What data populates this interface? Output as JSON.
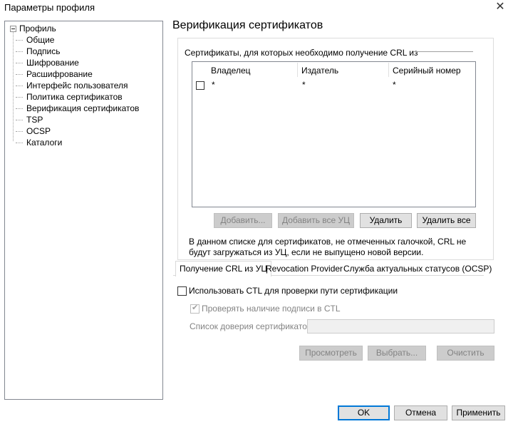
{
  "window": {
    "title": "Параметры профиля",
    "close_glyph": "✕"
  },
  "tree": {
    "root": "Профиль",
    "items": [
      "Общие",
      "Подпись",
      "Шифрование",
      "Расшифрование",
      "Интерфейс пользователя",
      "Политика сертификатов",
      "Верификация сертификатов",
      "TSP",
      "OCSP",
      "Каталоги"
    ],
    "selected": "Верификация сертификатов"
  },
  "page": {
    "title": "Верификация сертификатов",
    "group_caption": "Сертификаты, для которых необходимо получение CRL из",
    "table": {
      "columns": [
        "Владелец",
        "Издатель",
        "Серийный номер"
      ],
      "rows": [
        {
          "checked": false,
          "owner": "*",
          "issuer": "*",
          "serial": "*"
        }
      ]
    },
    "buttons": {
      "add": "Добавить...",
      "add_all_ca": "Добавить все УЦ",
      "remove": "Удалить",
      "remove_all": "Удалить все"
    },
    "note": "В данном списке для сертификатов, не отмеченных галочкой, CRL не будут загружаться из УЦ, если не выпущено новой версии."
  },
  "tabs": [
    {
      "label": "Получение CRL из УЦ",
      "active": true
    },
    {
      "label": "Revocation Provider",
      "active": false
    },
    {
      "label": "Служба актуальных статусов (OCSP)",
      "active": false
    }
  ],
  "ctl": {
    "use_ctl_label": "Использовать CTL для проверки пути сертификации",
    "use_ctl_checked": false,
    "verify_sig_label": "Проверять наличие подписи в CTL",
    "verify_sig_checked": true,
    "trust_list_label": "Список доверия сертификатов:",
    "trust_list_value": "",
    "buttons": {
      "view": "Просмотреть",
      "select": "Выбрать...",
      "clear": "Очистить"
    }
  },
  "footer": {
    "ok": "OK",
    "cancel": "Отмена",
    "apply": "Применить"
  }
}
